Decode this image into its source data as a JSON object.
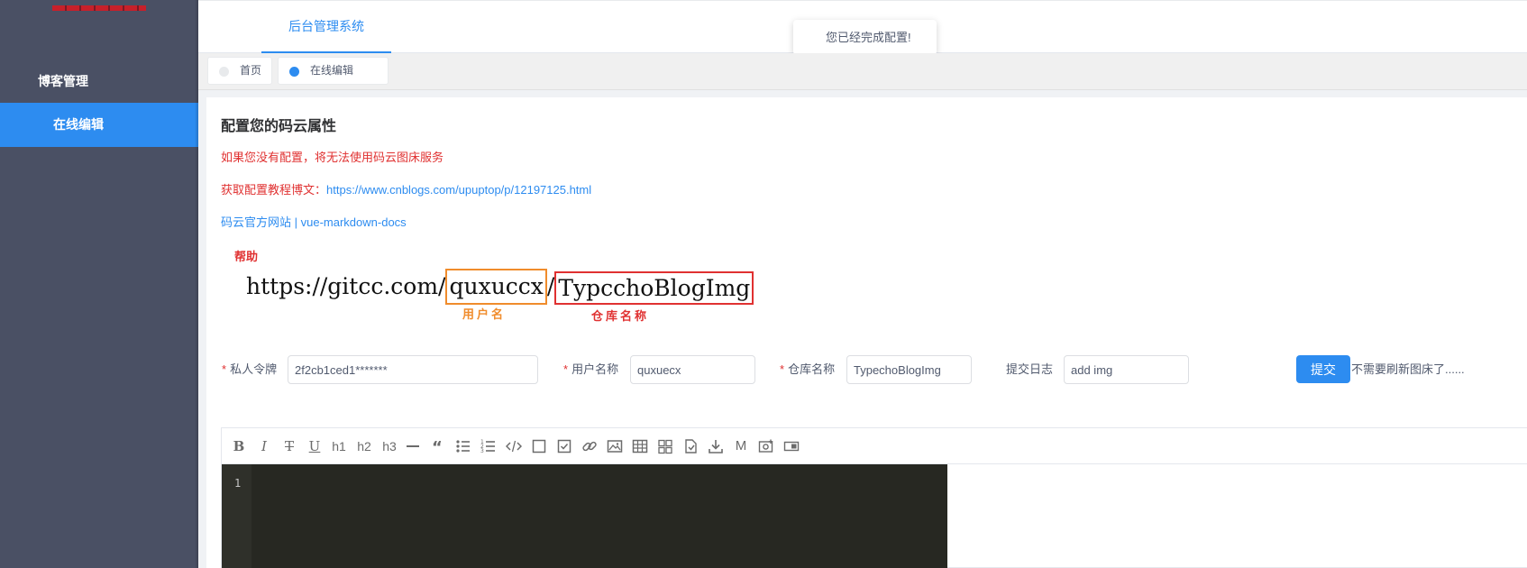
{
  "sidebar": {
    "group_label": "博客管理",
    "items": [
      {
        "label": "在线编辑"
      }
    ]
  },
  "header": {
    "app_tab": "后台管理系统"
  },
  "toast": {
    "message": "您已经完成配置!"
  },
  "tabs": [
    {
      "label": "首页"
    },
    {
      "label": "在线编辑"
    }
  ],
  "main": {
    "title": "配置您的码云属性",
    "warning": "如果您没有配置，将无法使用码云图床服务",
    "tutorial_prefix": "获取配置教程博文：",
    "tutorial_link": "https://www.cnblogs.com/upuptop/p/12197125.html",
    "link_gitee": "码云官方网站",
    "link_sep": " | ",
    "link_docs": "vue-markdown-docs"
  },
  "help": {
    "label": "帮助",
    "url_prefix": "https://gitcc.com/",
    "url_user": "quxuccx",
    "url_sep": "/",
    "url_repo": "TypcchoBlogImg",
    "user_caption": "用户名",
    "repo_caption": "仓库名称"
  },
  "form": {
    "token_label": "私人令牌",
    "token_value": "2f2cb1ced1*******",
    "user_label": "用户名称",
    "user_value": "quxuecx",
    "repo_label": "仓库名称",
    "repo_value": "TypechoBlogImg",
    "log_label": "提交日志",
    "log_value": "add img",
    "submit_label": "提交",
    "hint": "不需要刷新图床了......"
  },
  "editor": {
    "toolbar": {
      "h1": "h1",
      "h2": "h2",
      "h3": "h3",
      "M": "M"
    },
    "line_numbers": [
      "1"
    ]
  },
  "colors": {
    "accent": "#2d8cf0",
    "sidebar_bg": "#4a5064",
    "danger": "#e03131",
    "user_box": "#f08c2c",
    "editor_bg": "#272822"
  }
}
